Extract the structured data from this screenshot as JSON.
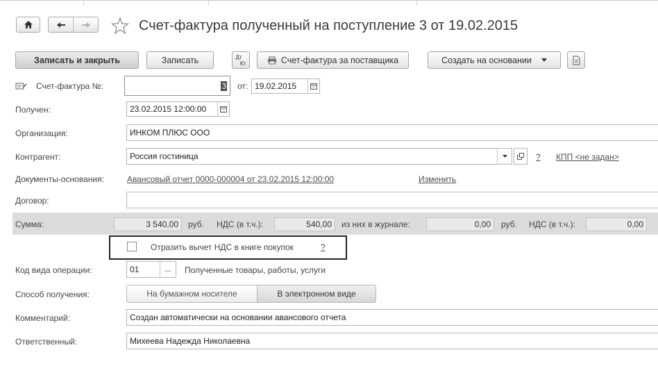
{
  "window": {
    "title": "Счет-фактура полученный на поступление 3 от 19.02.2015"
  },
  "toolbar": {
    "save_close_label": "Записать и закрыть",
    "save_label": "Записать",
    "dtkt_label_top": "Дт",
    "dtkt_label_bottom": "Кт",
    "print_label": "Счет-фактура за поставщика",
    "create_based_label": "Создать на основании"
  },
  "form": {
    "invoice_number_label": "Счет-фактура №:",
    "invoice_number_value": "3",
    "from_label": "от:",
    "invoice_date": "19.02.2015",
    "received_label": "Получен:",
    "received_value": "23.02.2015 12:00:00",
    "organization_label": "Организация:",
    "organization_value": "ИНКОМ ПЛЮС ООО",
    "counterparty_label": "Контрагент:",
    "counterparty_value": "Россия гостиница",
    "help_mark": "?",
    "kpp_link": "КПП <не задан>",
    "base_docs_label": "Документы-основания:",
    "base_docs_link": "Авансовый отчет 0000-000004 от 23.02.2015 12:00:00",
    "change_link": "Изменить",
    "contract_label": "Договор:",
    "contract_value": "",
    "sum_label": "Сумма:",
    "sum_value": "3 540,00",
    "currency_1": "руб.",
    "vat_label_1": "НДС (в т.ч.):",
    "vat_value_1": "540,00",
    "journal_label": "из них в журнале:",
    "journal_value": "0,00",
    "currency_2": "руб.",
    "vat_label_2": "НДС (в т.ч.):",
    "vat_value_2": "0,00",
    "reflect_vat_label": "Отразить вычет НДС в книге покупок",
    "reflect_vat_checked": false,
    "reflect_help": "?",
    "op_code_label": "Код вида операции:",
    "op_code_value": "01",
    "op_code_select": "...",
    "op_code_desc": "Полученные товары, работы, услуги",
    "method_label": "Способ получения:",
    "method_paper": "На бумажном носителе",
    "method_electronic": "В электронном виде",
    "method_selected": "В электронном виде",
    "comment_label": "Комментарий:",
    "comment_value": "Создан автоматически на основании авансового отчета",
    "responsible_label": "Ответственный:",
    "responsible_value": "Михеева Надежда Николаевна"
  }
}
